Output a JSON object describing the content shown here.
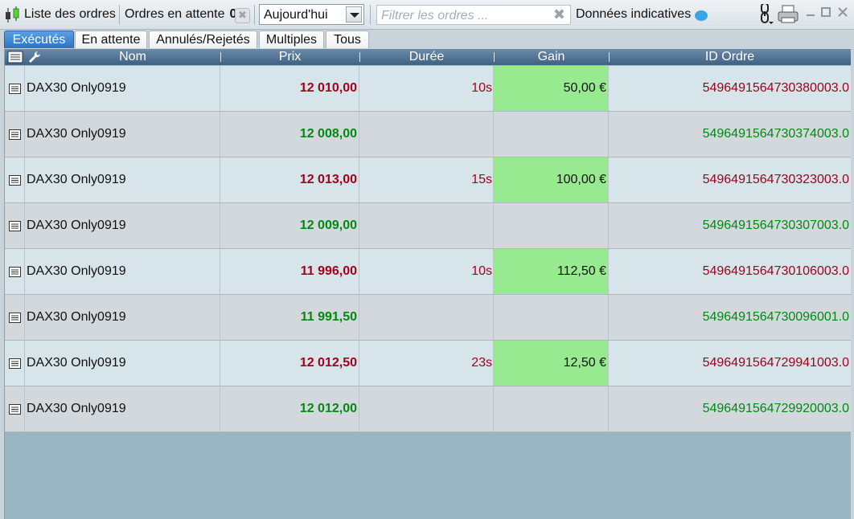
{
  "toolbar": {
    "title": "Liste des ordres",
    "pending_label": "Ordres en attente",
    "pending_count": "0",
    "period_value": "Aujourd'hui",
    "filter_placeholder": "Filtrer les ordres ...",
    "indicative_label": "Données indicatives",
    "icons": [
      "candlestick-icon",
      "clear-icon",
      "dropdown-arrow-icon",
      "clear-filter-icon",
      "speech-bubble-icon",
      "connection-icon",
      "printer-icon",
      "minimize-icon",
      "maximize-icon",
      "close-icon"
    ]
  },
  "tabs": [
    {
      "label": "Exécutés",
      "active": true
    },
    {
      "label": "En attente",
      "active": false
    },
    {
      "label": "Annulés/Rejetés",
      "active": false
    },
    {
      "label": "Multiples",
      "active": false
    },
    {
      "label": "Tous",
      "active": false
    }
  ],
  "table": {
    "columns": {
      "name": "Nom",
      "price": "Prix",
      "duration": "Durée",
      "gain": "Gain",
      "order_id": "ID Ordre"
    },
    "header_icons": [
      "list-icon",
      "wrench-icon"
    ],
    "rows": [
      {
        "name": "DAX30 Only0919",
        "price": "12 010,00",
        "duration": "10s",
        "gain": "50,00 €",
        "order_id": "5496491564730380003.0",
        "side": "sell"
      },
      {
        "name": "DAX30 Only0919",
        "price": "12 008,00",
        "duration": "",
        "gain": "",
        "order_id": "5496491564730374003.0",
        "side": "buy"
      },
      {
        "name": "DAX30 Only0919",
        "price": "12 013,00",
        "duration": "15s",
        "gain": "100,00 €",
        "order_id": "5496491564730323003.0",
        "side": "sell"
      },
      {
        "name": "DAX30 Only0919",
        "price": "12 009,00",
        "duration": "",
        "gain": "",
        "order_id": "5496491564730307003.0",
        "side": "buy"
      },
      {
        "name": "DAX30 Only0919",
        "price": "11 996,00",
        "duration": "10s",
        "gain": "112,50 €",
        "order_id": "5496491564730106003.0",
        "side": "sell"
      },
      {
        "name": "DAX30 Only0919",
        "price": "11 991,50",
        "duration": "",
        "gain": "",
        "order_id": "5496491564730096001.0",
        "side": "buy"
      },
      {
        "name": "DAX30 Only0919",
        "price": "12 012,50",
        "duration": "23s",
        "gain": "12,50 €",
        "order_id": "5496491564729941003.0",
        "side": "sell"
      },
      {
        "name": "DAX30 Only0919",
        "price": "12 012,00",
        "duration": "",
        "gain": "",
        "order_id": "5496491564729920003.0",
        "side": "buy"
      }
    ]
  },
  "colors": {
    "sell_text": "#a4001a",
    "buy_text": "#008a12",
    "gain_background": "#98ea90",
    "active_tab": "#2d73c4"
  }
}
